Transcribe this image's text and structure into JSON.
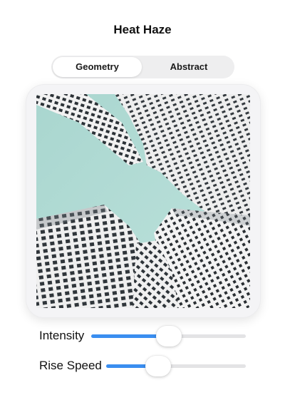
{
  "header": {
    "title": "Heat Haze"
  },
  "mode_selector": {
    "options": [
      "Geometry",
      "Abstract"
    ],
    "selected": "Geometry"
  },
  "preview": {
    "subject": "looking-up-at-modular-high-rise-facades",
    "sky_color": "#b3dcd5",
    "facade_color": "#f1f1f1",
    "window_color": "#2c3237"
  },
  "sliders": [
    {
      "label": "Intensity",
      "value": 0.5
    },
    {
      "label": "Rise Speed",
      "value": 0.37
    }
  ],
  "colors": {
    "accent": "#3a8ef0",
    "track": "#e3e3e5",
    "segment_bg": "#eeeeef"
  }
}
